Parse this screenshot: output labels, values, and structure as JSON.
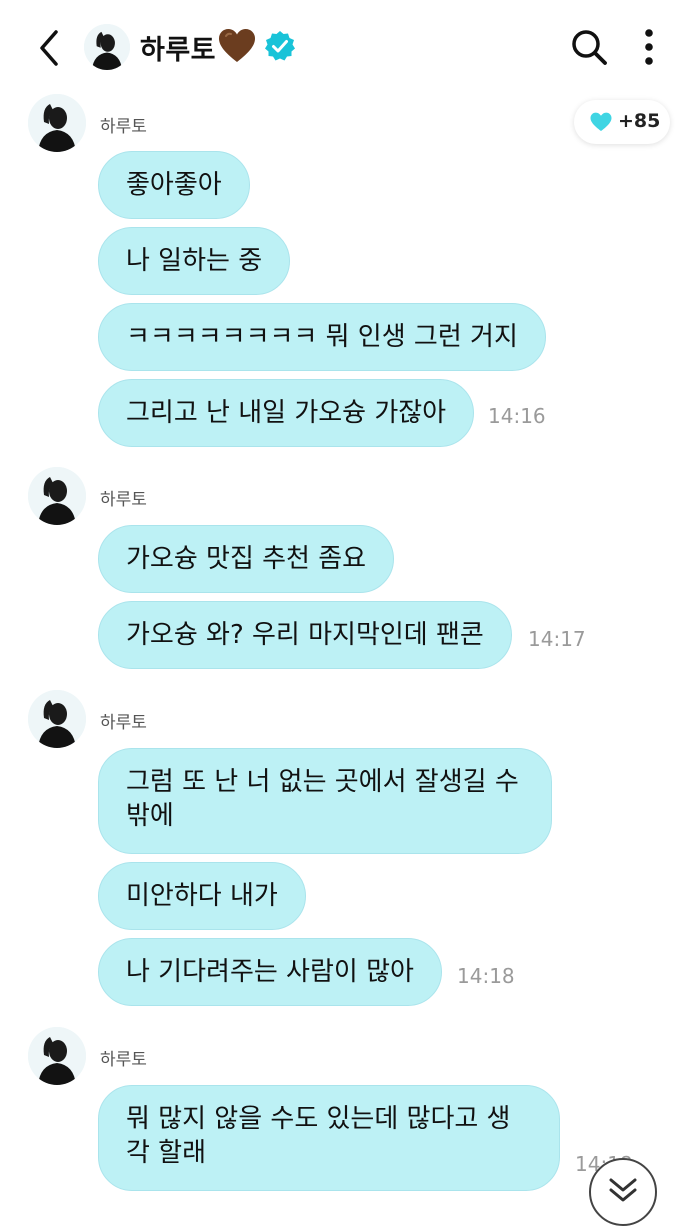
{
  "header": {
    "title": "하루토",
    "back_icon": "chevron-left-icon",
    "search_icon": "search-icon",
    "more_icon": "more-vertical-icon",
    "verified_color": "#19c3d8"
  },
  "heart_counter": {
    "label": "+85",
    "color": "#3fd5e3"
  },
  "groups": [
    {
      "sender": "하루토",
      "messages": [
        "좋아좋아",
        "나 일하는 중",
        "ㅋㅋㅋㅋㅋㅋㅋㅋ 뭐 인생 그런 거지",
        "그리고 난 내일 가오슝 가잖아"
      ],
      "time": "14:16"
    },
    {
      "sender": "하루토",
      "messages": [
        "가오슝 맛집 추천 좀요",
        "가오슝 와? 우리 마지막인데 팬콘"
      ],
      "time": "14:17"
    },
    {
      "sender": "하루토",
      "messages": [
        "그럼 또 난 너 없는 곳에서 잘생길 수 밖에",
        "미안하다 내가",
        "나 기다려주는 사람이 많아"
      ],
      "time": "14:18"
    },
    {
      "sender": "하루토",
      "messages": [
        "뭐 많지 않을 수도 있는데 많다고 생각 할래"
      ],
      "time": "14:18"
    }
  ],
  "colors": {
    "bubble": "#bdf1f5",
    "timestamp": "#9a9a9a"
  }
}
